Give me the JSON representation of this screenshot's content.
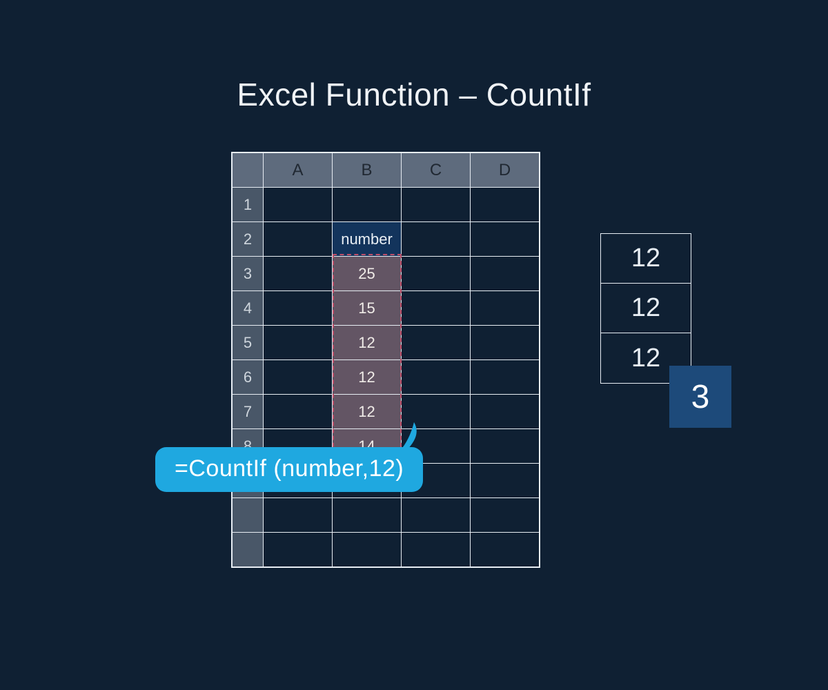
{
  "title": "Excel Function – CountIf",
  "sheet": {
    "columns": [
      "A",
      "B",
      "C",
      "D"
    ],
    "row_numbers": [
      "1",
      "2",
      "3",
      "4",
      "5",
      "6",
      "7",
      "8",
      "",
      "",
      ""
    ],
    "range_header_cell": "number",
    "range_values": [
      "25",
      "15",
      "12",
      "12",
      "12",
      "14"
    ]
  },
  "formula": "=CountIf (number,12)",
  "stack": [
    "12",
    "12",
    "12"
  ],
  "result": "3",
  "chart_data": {
    "type": "table",
    "title": "Excel Function – CountIf",
    "named_range": "number",
    "range_address": "B3:B8",
    "values": [
      25,
      15,
      12,
      12,
      12,
      14
    ],
    "criteria": 12,
    "matches": [
      12,
      12,
      12
    ],
    "formula": "=CountIf(number,12)",
    "result": 3
  }
}
